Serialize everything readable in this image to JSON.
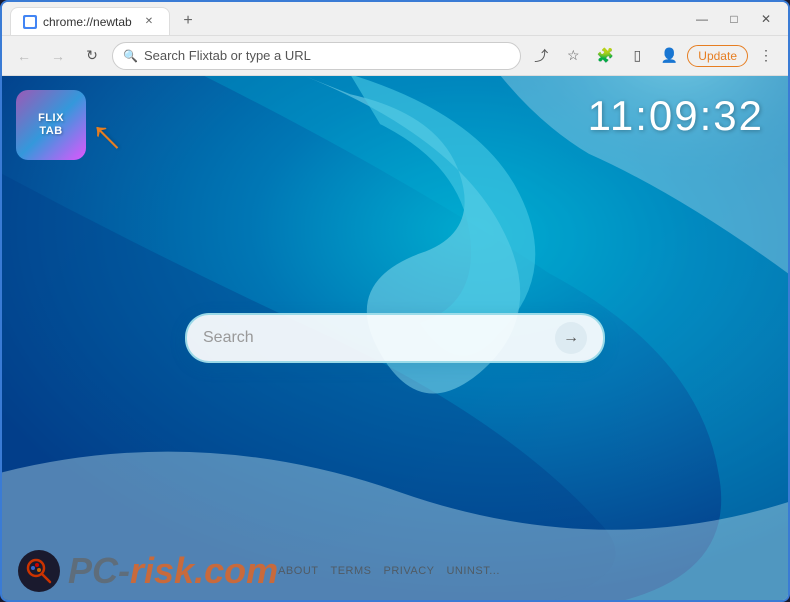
{
  "window": {
    "title": "chrome://newtab",
    "tab_label": "chrome://newtab",
    "new_tab_symbol": "+",
    "controls": {
      "minimize": "—",
      "maximize": "□",
      "close": "✕"
    }
  },
  "navbar": {
    "back_label": "←",
    "forward_label": "→",
    "refresh_label": "↻",
    "address_placeholder": "Search Flixtab or type a URL",
    "address_value": "Search Flixtab or type a URL",
    "update_label": "Update",
    "share_icon": "⤴",
    "star_icon": "☆",
    "extensions_icon": "⋮",
    "sidebar_icon": "▯",
    "profile_icon": "👤",
    "more_icon": "⋮"
  },
  "page": {
    "clock": "11:09:32",
    "flix_tab": {
      "line1": "FLIX",
      "line2": "TAB"
    },
    "search": {
      "placeholder": "Search",
      "arrow": "→"
    },
    "footer": {
      "about": "ABOUT",
      "terms": "TERMS",
      "privacy": "PRIVACY",
      "uninstall": "UNINST..."
    }
  },
  "colors": {
    "tab_accent": "#4285f4",
    "update_btn": "#e67e22",
    "ocean_deep": "#006994",
    "flix_gradient_start": "#9b59b6",
    "flix_gradient_end": "#3498db",
    "clock_color": "#ffffff",
    "arrow_color": "#e67e22"
  }
}
